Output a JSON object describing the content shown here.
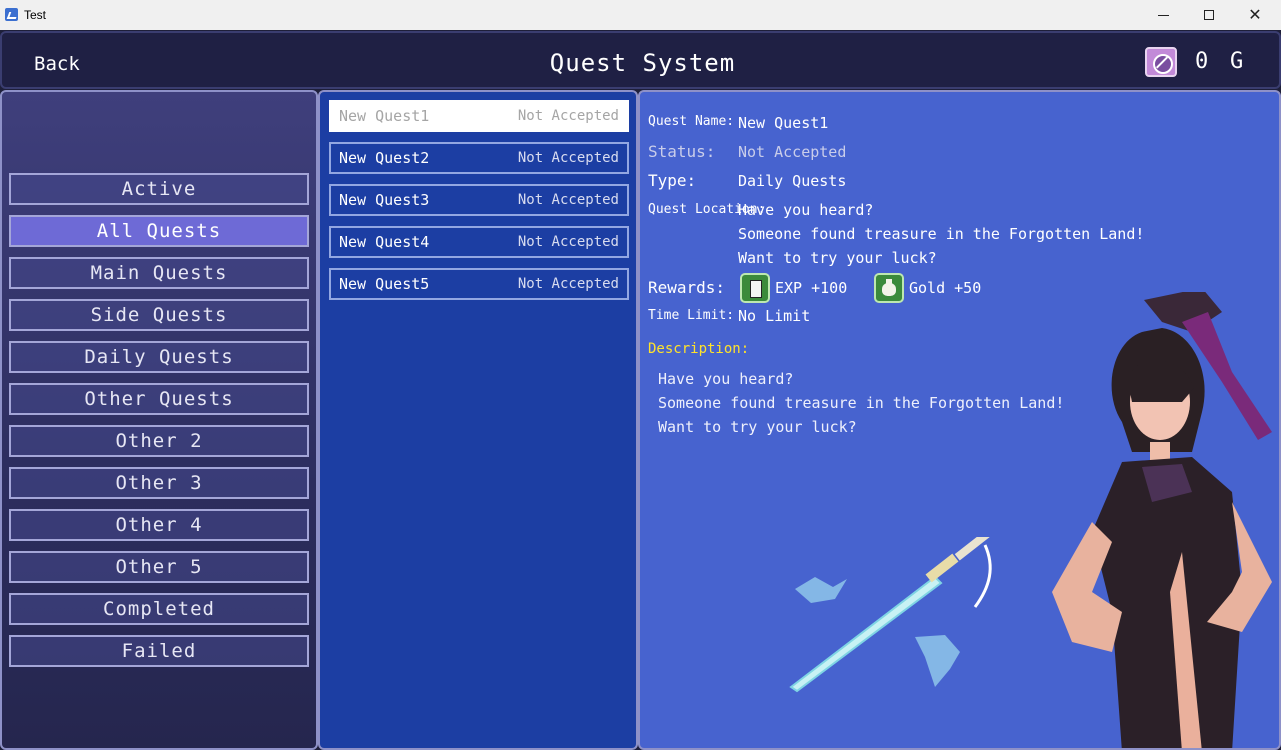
{
  "window": {
    "title": "Test"
  },
  "header": {
    "back_label": "Back",
    "title": "Quest System",
    "gold_amount": "0",
    "gold_unit": "G",
    "gold_icon": "gold-coin-icon"
  },
  "categories": [
    {
      "label": "Active"
    },
    {
      "label": "All Quests",
      "selected": true
    },
    {
      "label": "Main Quests"
    },
    {
      "label": "Side Quests"
    },
    {
      "label": "Daily Quests"
    },
    {
      "label": "Other Quests"
    },
    {
      "label": "Other 2"
    },
    {
      "label": "Other 3"
    },
    {
      "label": "Other 4"
    },
    {
      "label": "Other 5"
    },
    {
      "label": "Completed"
    },
    {
      "label": "Failed"
    }
  ],
  "quests": [
    {
      "name": "New Quest1",
      "status": "Not Accepted",
      "selected": true
    },
    {
      "name": "New Quest2",
      "status": "Not Accepted"
    },
    {
      "name": "New Quest3",
      "status": "Not Accepted"
    },
    {
      "name": "New Quest4",
      "status": "Not Accepted"
    },
    {
      "name": "New Quest5",
      "status": "Not Accepted"
    }
  ],
  "detail": {
    "name_label": "Quest Name:",
    "name_value": "New Quest1",
    "status_label": "Status:",
    "status_value": "Not Accepted",
    "type_label": "Type:",
    "type_value": "Daily Quests",
    "location_label": "Quest Location:",
    "location_lines": [
      "Have you heard?",
      "Someone found treasure in the Forgotten Land!",
      "Want to try your luck?"
    ],
    "rewards_label": "Rewards:",
    "rewards": [
      {
        "icon": "exp-book-icon",
        "text": "EXP +100"
      },
      {
        "icon": "gold-bag-icon",
        "text": "Gold +50"
      }
    ],
    "time_limit_label": "Time Limit:",
    "time_limit_value": "No Limit",
    "description_label": "Description:",
    "description_lines": [
      "Have you heard?",
      "Someone found treasure in the Forgotten Land!",
      "Want to try your luck?"
    ]
  }
}
